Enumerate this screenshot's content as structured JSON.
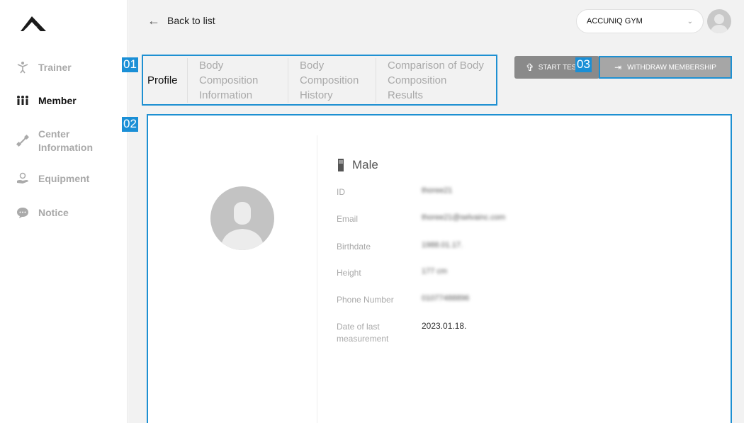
{
  "sidebar": {
    "items": [
      {
        "label": "Trainer",
        "icon": "trainer-icon"
      },
      {
        "label": "Member",
        "icon": "member-icon"
      },
      {
        "label": "Center Information",
        "icon": "center-icon"
      },
      {
        "label": "Equipment",
        "icon": "equipment-icon"
      },
      {
        "label": "Notice",
        "icon": "notice-icon"
      }
    ]
  },
  "topbar": {
    "back_label": "Back to list",
    "gym_name": "ACCUNIQ GYM"
  },
  "tabs": [
    {
      "label": "Profile"
    },
    {
      "label": "Body Composition Information"
    },
    {
      "label": "Body Composition History"
    },
    {
      "label": "Comparison of Body Composition Results"
    }
  ],
  "actions": {
    "start_label": "START TEST",
    "withdraw_label": "WITHDRAW MEMBERSHIP"
  },
  "badges": [
    "01",
    "02",
    "03"
  ],
  "profile": {
    "gender": "Male",
    "fields": [
      {
        "label": "ID",
        "value": "thoree21"
      },
      {
        "label": "Email",
        "value": "thoree21@selvainc.com"
      },
      {
        "label": "Birthdate",
        "value": "1988.01.17."
      },
      {
        "label": "Height",
        "value": "177 cm"
      },
      {
        "label": "Phone Number",
        "value": "01077488896"
      },
      {
        "label": "Date of last measurement",
        "value": "2023.01.18."
      }
    ]
  },
  "colors": {
    "accent": "#1e90d2",
    "badge": "#1a8fd6",
    "button_dark": "#8a8a8a",
    "button_light": "#a6a6a6"
  }
}
